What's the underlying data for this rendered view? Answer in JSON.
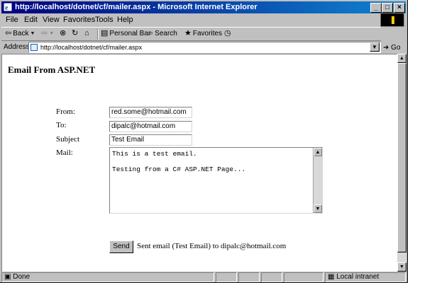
{
  "window": {
    "title": "http://localhost/dotnet/cf/mailer.aspx - Microsoft Internet Explorer",
    "controls": {
      "minimize": "_",
      "maximize": "□",
      "close": "×"
    }
  },
  "menu": {
    "items": [
      "File",
      "Edit",
      "View",
      "Favorites",
      "Tools",
      "Help"
    ]
  },
  "toolbar": {
    "back_label": "Back",
    "personal_bar_label": "Personal Bar",
    "search_label": "Search",
    "favorites_label": "Favorites"
  },
  "address": {
    "label": "Address",
    "url": "http://localhost/dotnet/cf/mailer.aspx",
    "go_label": "Go"
  },
  "page": {
    "title": "Email From ASP.NET",
    "from_label": "From:",
    "to_label": "To:",
    "subject_label": "Subject",
    "mail_label": "Mail:",
    "from_value": "red.some@hotmail.com",
    "to_value": "dipalc@hotmail.com",
    "subject_value": "Test Email",
    "mail_body": "This is a test email.\n\nTesting from a C# ASP.NET Page...",
    "send_label": "Send",
    "result_text": "Sent email (Test Email) to dipalc@hotmail.com"
  },
  "status": {
    "text": "Done",
    "zone": "Local intranet"
  }
}
